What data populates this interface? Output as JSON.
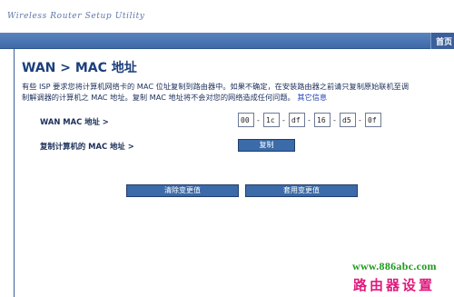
{
  "header": {
    "brand": "Wireless Router Setup Utility",
    "nav_tab": "首页"
  },
  "page": {
    "title": "WAN > MAC 地址",
    "description": "有些 ISP 要求您将计算机网络卡的 MAC 位址复制到路由器中。如果不确定，在安装路由器之前请只复制原始联机至调制解调器的计算机之 MAC 地址。复制 MAC 地址将不会对您的网络造成任何问题。",
    "more_info_link": "其它信息"
  },
  "form": {
    "mac_label": "WAN MAC 地址 >",
    "mac_octets": [
      "00",
      "1c",
      "df",
      "16",
      "d5",
      "0f"
    ],
    "mac_separator": "-",
    "clone_label": "复制计算机的 MAC 地址 >",
    "clone_button": "复制"
  },
  "actions": {
    "clear_button": "清除变更值",
    "apply_button": "套用变更值"
  },
  "watermark": {
    "url": "www.886abc.com",
    "name": "路由器设置"
  },
  "colors": {
    "nav_blue": "#3e69a7",
    "title_blue": "#1c3f7c",
    "button_blue": "#3b6ba8",
    "watermark_green": "#1d9a1d",
    "watermark_pink": "#e0197d"
  }
}
